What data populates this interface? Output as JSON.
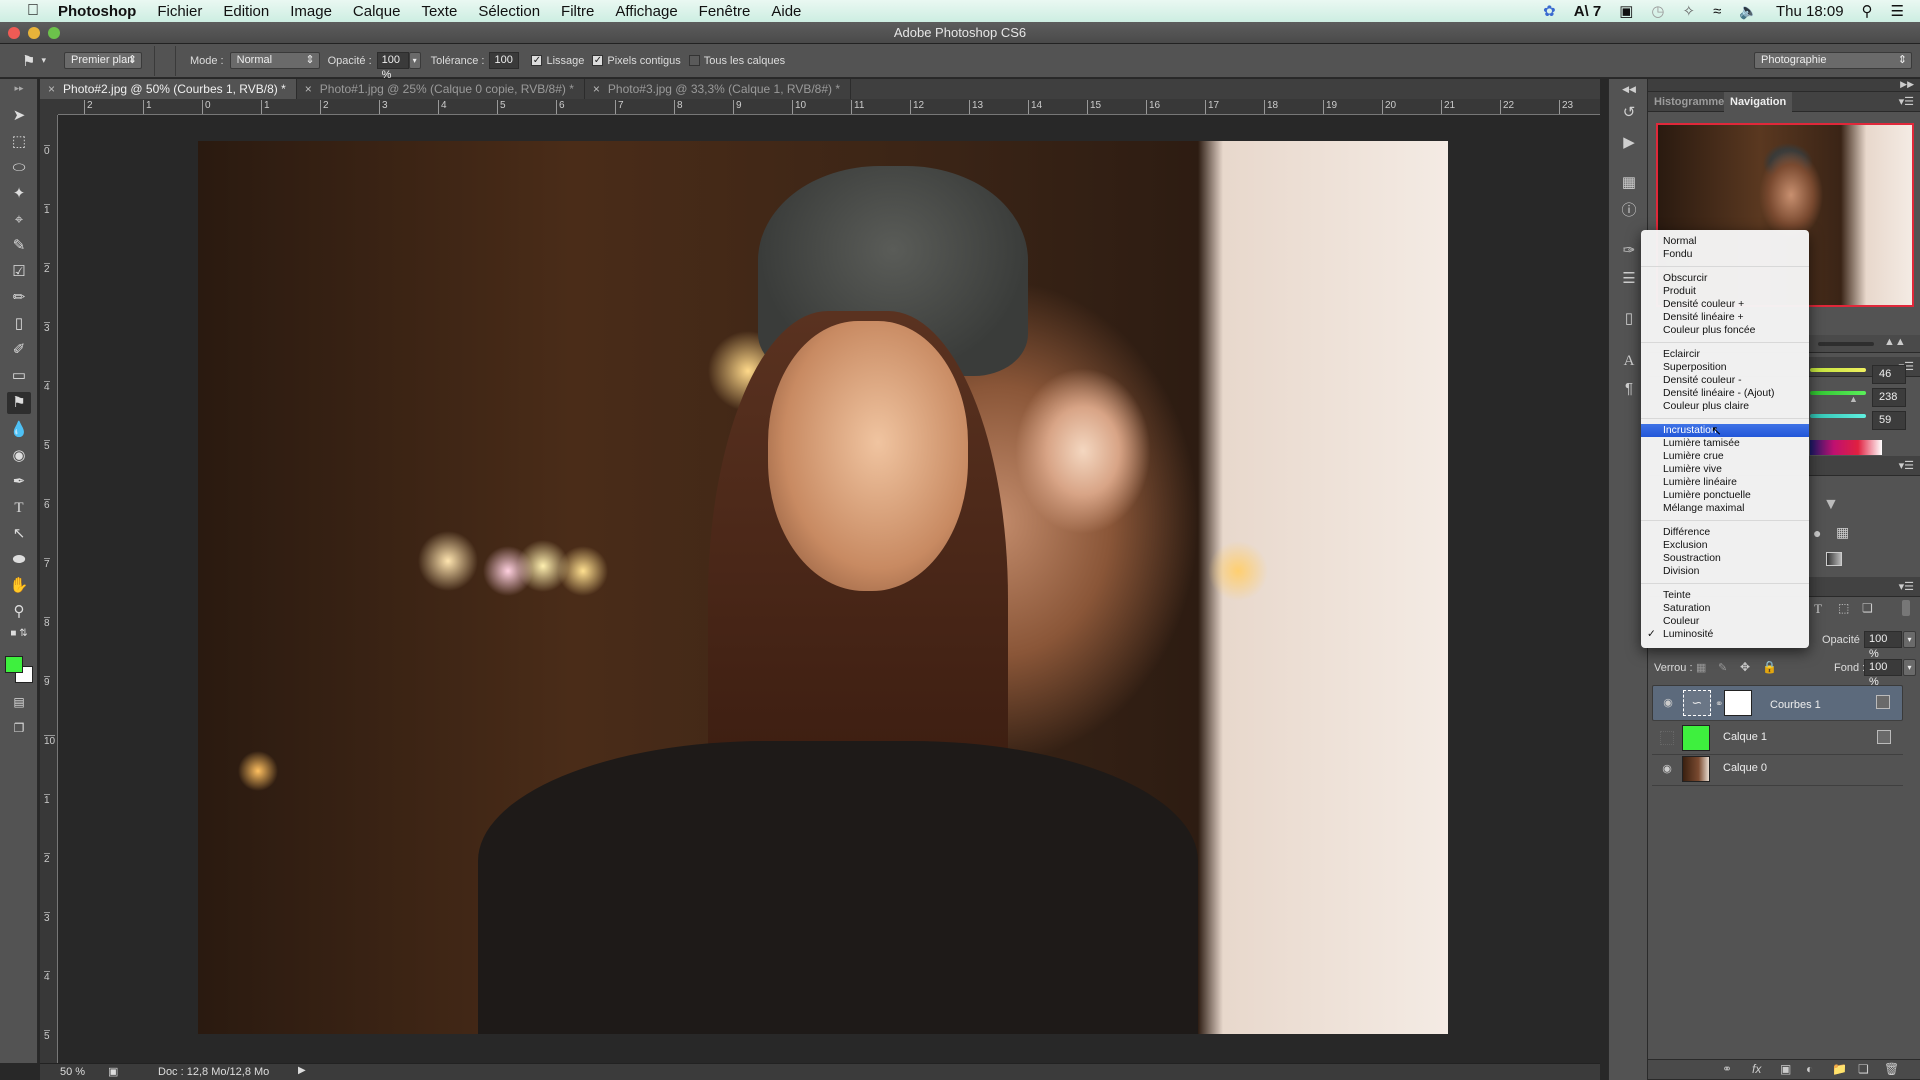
{
  "menubar": {
    "app": "Photoshop",
    "items": [
      "Fichier",
      "Edition",
      "Image",
      "Calque",
      "Texte",
      "Sélection",
      "Filtre",
      "Affichage",
      "Fenêtre",
      "Aide"
    ],
    "status": {
      "adobe_count": "7",
      "clock": "Thu 18:09"
    }
  },
  "window": {
    "title": "Adobe Photoshop CS6"
  },
  "options": {
    "fill_source": "Premier plan",
    "mode_label": "Mode :",
    "mode_value": "Normal",
    "opacity_label": "Opacité :",
    "opacity_value": "100 %",
    "tolerance_label": "Tolérance :",
    "tolerance_value": "100",
    "antialias_label": "Lissage",
    "antialias_checked": true,
    "contiguous_label": "Pixels contigus",
    "contiguous_checked": true,
    "all_layers_label": "Tous les calques",
    "all_layers_checked": false,
    "workspace": "Photographie"
  },
  "tabs": [
    {
      "label": "Photo#2.jpg @ 50% (Courbes 1, RVB/8) *",
      "active": true
    },
    {
      "label": "Photo#1.jpg @ 25% (Calque 0 copie, RVB/8#) *",
      "active": false
    },
    {
      "label": "Photo#3.jpg @ 33,3% (Calque 1, RVB/8#) *",
      "active": false
    }
  ],
  "ruler": {
    "h_labels": [
      "2",
      "1",
      "0",
      "1",
      "2",
      "3",
      "4",
      "5",
      "6",
      "7",
      "8",
      "9",
      "10",
      "11",
      "12",
      "13",
      "14",
      "15",
      "16",
      "17",
      "18",
      "19",
      "20",
      "21",
      "22",
      "23"
    ],
    "v_labels": [
      "0",
      "1",
      "2",
      "3",
      "4",
      "5",
      "6",
      "7",
      "8",
      "9",
      "10",
      "1",
      "2",
      "3",
      "4",
      "5"
    ]
  },
  "colors": {
    "foreground": "#3ef03e",
    "background": "#ffffff",
    "accent_highlight": "#2b5fde"
  },
  "status": {
    "zoom": "50 %",
    "doc": "Doc : 12,8 Mo/12,8 Mo"
  },
  "panels": {
    "nav_tabs": [
      {
        "label": "Histogramme",
        "active": false
      },
      {
        "label": "Navigation",
        "active": true
      }
    ],
    "color_values": {
      "r": "46",
      "g": "238",
      "b": "59"
    },
    "layers": {
      "opacity_label": "Opacité :",
      "opacity_value": "100 %",
      "lock_label": "Verrou :",
      "fill_label": "Fond :",
      "fill_value": "100 %",
      "items": [
        {
          "name": "Courbes 1",
          "visible": true,
          "selected": true
        },
        {
          "name": "Calque 1",
          "visible": false,
          "selected": false
        },
        {
          "name": "Calque 0",
          "visible": true,
          "selected": false
        }
      ]
    }
  },
  "blend_menu": {
    "groups": [
      [
        "Normal",
        "Fondu"
      ],
      [
        "Obscurcir",
        "Produit",
        "Densité couleur +",
        "Densité linéaire +",
        "Couleur plus foncée"
      ],
      [
        "Eclaircir",
        "Superposition",
        "Densité couleur -",
        "Densité linéaire - (Ajout)",
        "Couleur plus claire"
      ],
      [
        "Incrustation",
        "Lumière tamisée",
        "Lumière crue",
        "Lumière vive",
        "Lumière linéaire",
        "Lumière ponctuelle",
        "Mélange maximal"
      ],
      [
        "Différence",
        "Exclusion",
        "Soustraction",
        "Division"
      ],
      [
        "Teinte",
        "Saturation",
        "Couleur",
        "Luminosité"
      ]
    ],
    "highlighted": "Incrustation",
    "checked": "Luminosité"
  }
}
